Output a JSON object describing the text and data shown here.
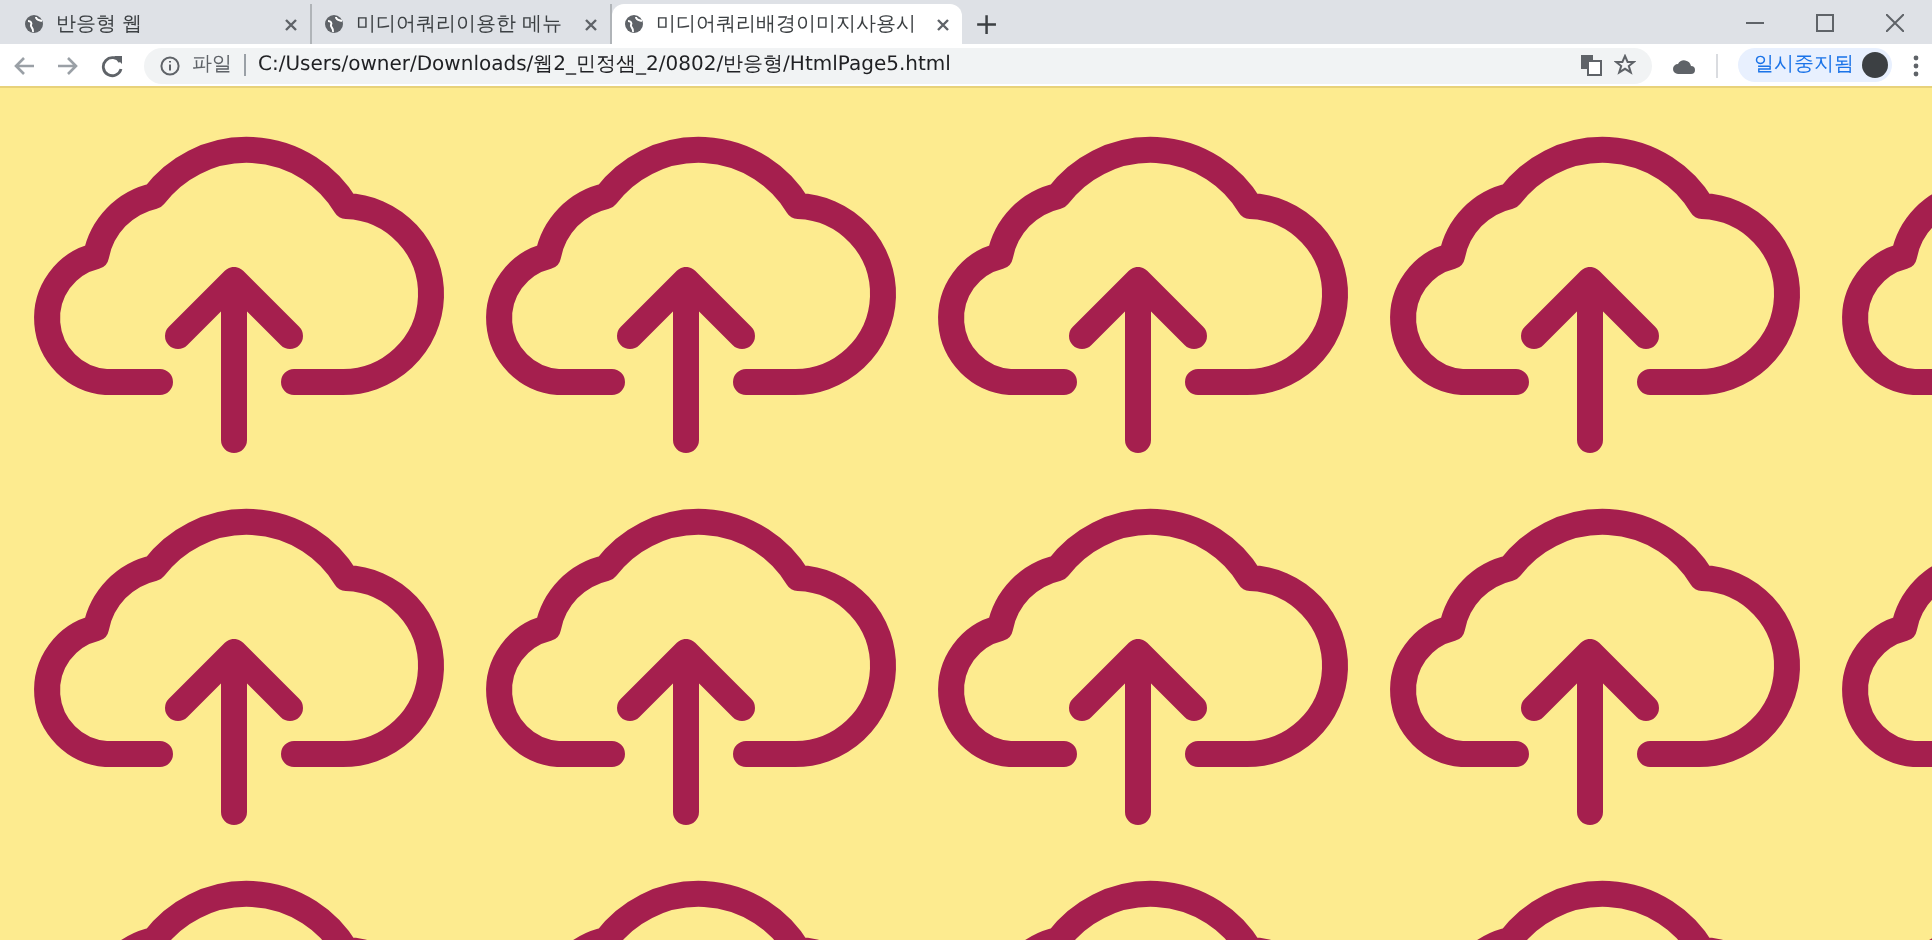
{
  "tabs": [
    {
      "title": "반응형 웹",
      "selected": false
    },
    {
      "title": "미디어쿼리이용한 메뉴",
      "selected": false
    },
    {
      "title": "미디어쿼리배경이미지사용시",
      "selected": true
    }
  ],
  "new_tab": "+",
  "address_bar": {
    "scheme": "파일",
    "url": "C:/Users/owner/Downloads/웹2_민정샘_2/0802/반응형/HtmlPage5.html"
  },
  "profile": {
    "status": "일시중지됨"
  }
}
